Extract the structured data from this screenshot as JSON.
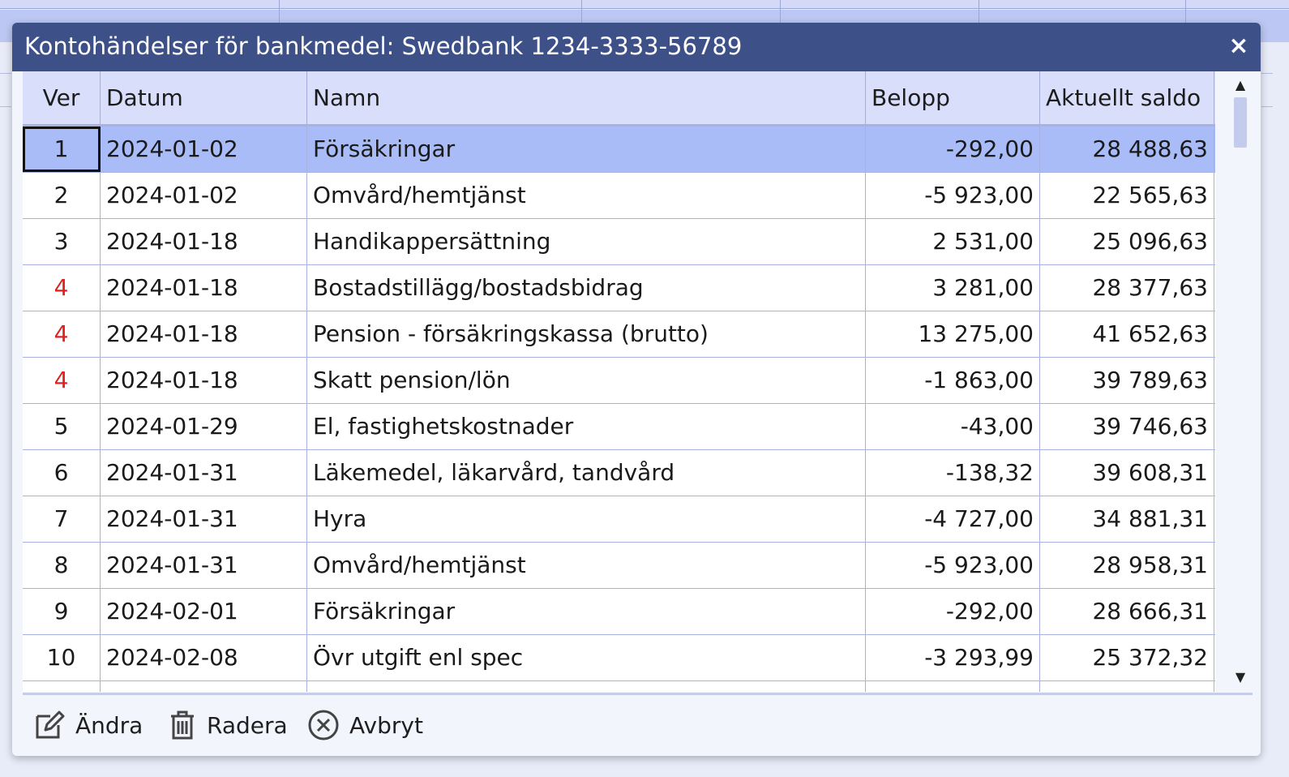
{
  "dialog": {
    "title": "Kontohändelser för bankmedel: Swedbank 1234-3333-56789",
    "close_label": "×"
  },
  "columns": [
    "Ver",
    "Datum",
    "Namn",
    "Belopp",
    "Aktuellt saldo"
  ],
  "rows": [
    {
      "ver": "1",
      "datum": "2024-01-02",
      "namn": "Försäkringar",
      "belopp": "-292,00",
      "saldo": "28 488,63"
    },
    {
      "ver": "2",
      "datum": "2024-01-02",
      "namn": "Omvård/hemtjänst",
      "belopp": "-5 923,00",
      "saldo": "22 565,63"
    },
    {
      "ver": "3",
      "datum": "2024-01-18",
      "namn": "Handikappersättning",
      "belopp": "2 531,00",
      "saldo": "25 096,63"
    },
    {
      "ver": "4",
      "datum": "2024-01-18",
      "namn": "Bostadstillägg/bostadsbidrag",
      "belopp": "3 281,00",
      "saldo": "28 377,63"
    },
    {
      "ver": "4",
      "datum": "2024-01-18",
      "namn": "Pension - försäkringskassa (brutto)",
      "belopp": "13 275,00",
      "saldo": "41 652,63"
    },
    {
      "ver": "4",
      "datum": "2024-01-18",
      "namn": "Skatt pension/lön",
      "belopp": "-1 863,00",
      "saldo": "39 789,63"
    },
    {
      "ver": "5",
      "datum": "2024-01-29",
      "namn": "El, fastighetskostnader",
      "belopp": "-43,00",
      "saldo": "39 746,63"
    },
    {
      "ver": "6",
      "datum": "2024-01-31",
      "namn": "Läkemedel, läkarvård, tandvård",
      "belopp": "-138,32",
      "saldo": "39 608,31"
    },
    {
      "ver": "7",
      "datum": "2024-01-31",
      "namn": "Hyra",
      "belopp": "-4 727,00",
      "saldo": "34 881,31"
    },
    {
      "ver": "8",
      "datum": "2024-01-31",
      "namn": "Omvård/hemtjänst",
      "belopp": "-5 923,00",
      "saldo": "28 958,31"
    },
    {
      "ver": "9",
      "datum": "2024-02-01",
      "namn": "Försäkringar",
      "belopp": "-292,00",
      "saldo": "28 666,31"
    },
    {
      "ver": "10",
      "datum": "2024-02-08",
      "namn": "Övr utgift enl spec",
      "belopp": "-3 293,99",
      "saldo": "25 372,32"
    }
  ],
  "selected_row_index": 0,
  "red_ver_rows": [
    3,
    4,
    5
  ],
  "colors": {
    "titlebar": "#3d5188",
    "header": "#d9defa",
    "selected_row": "#a9bcf7",
    "red_ver": "#e02020"
  },
  "toolbar": {
    "edit_label": "Ändra",
    "delete_label": "Radera",
    "cancel_label": "Avbryt"
  }
}
